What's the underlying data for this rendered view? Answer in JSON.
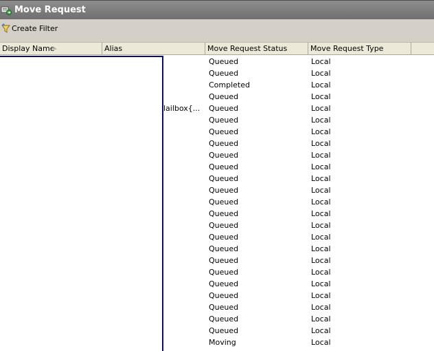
{
  "window": {
    "title": "Move Request"
  },
  "toolbar": {
    "create_filter_label": "Create Filter"
  },
  "columns": [
    {
      "label": "Display Name",
      "sorted": "ascending"
    },
    {
      "label": "Alias"
    },
    {
      "label": "Move Request Status"
    },
    {
      "label": "Move Request Type"
    }
  ],
  "alias_fragment": "lailbox{...",
  "rows": [
    {
      "status": "Queued",
      "type": "Local"
    },
    {
      "status": "Queued",
      "type": "Local"
    },
    {
      "status": "Completed",
      "type": "Local"
    },
    {
      "status": "Queued",
      "type": "Local"
    },
    {
      "status": "Queued",
      "type": "Local"
    },
    {
      "status": "Queued",
      "type": "Local"
    },
    {
      "status": "Queued",
      "type": "Local"
    },
    {
      "status": "Queued",
      "type": "Local"
    },
    {
      "status": "Queued",
      "type": "Local"
    },
    {
      "status": "Queued",
      "type": "Local"
    },
    {
      "status": "Queued",
      "type": "Local"
    },
    {
      "status": "Queued",
      "type": "Local"
    },
    {
      "status": "Queued",
      "type": "Local"
    },
    {
      "status": "Queued",
      "type": "Local"
    },
    {
      "status": "Queued",
      "type": "Local"
    },
    {
      "status": "Queued",
      "type": "Local"
    },
    {
      "status": "Queued",
      "type": "Local"
    },
    {
      "status": "Queued",
      "type": "Local"
    },
    {
      "status": "Queued",
      "type": "Local"
    },
    {
      "status": "Queued",
      "type": "Local"
    },
    {
      "status": "Queued",
      "type": "Local"
    },
    {
      "status": "Queued",
      "type": "Local"
    },
    {
      "status": "Queued",
      "type": "Local"
    },
    {
      "status": "Queued",
      "type": "Local"
    },
    {
      "status": "Moving",
      "type": "Local"
    }
  ]
}
